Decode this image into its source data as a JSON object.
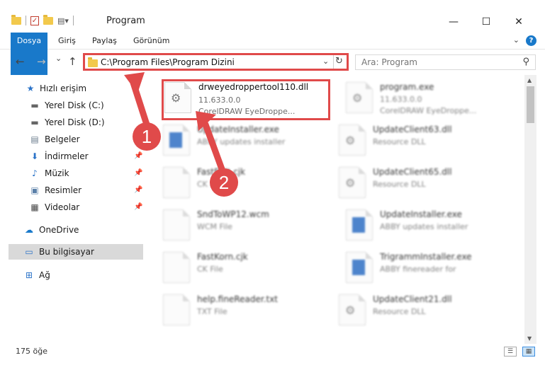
{
  "window": {
    "title": "Program",
    "minimize_glyph": "—",
    "maximize_glyph": "☐",
    "close_glyph": "✕"
  },
  "ribbon": {
    "tabs": [
      "Dosya",
      "Giriş",
      "Paylaş",
      "Görünüm"
    ],
    "help": "?"
  },
  "navbar": {
    "back": "←",
    "forward": "→",
    "recent": "⌄",
    "up": "↑",
    "address": "C:\\Program Files\\Program Dizini",
    "search_placeholder": "Ara: Program"
  },
  "sidebar": {
    "items": [
      {
        "label": "Hızlı erişim",
        "icon": "star-icon",
        "pinned": false
      },
      {
        "label": "Yerel Disk (C:)",
        "icon": "drive-icon",
        "pinned": false
      },
      {
        "label": "Yerel Disk (D:)",
        "icon": "drive-icon",
        "pinned": false
      },
      {
        "label": "Belgeler",
        "icon": "documents-icon",
        "pinned": false
      },
      {
        "label": "İndirmeler",
        "icon": "download-icon",
        "pinned": true
      },
      {
        "label": "Müzik",
        "icon": "music-icon",
        "pinned": true
      },
      {
        "label": "Resimler",
        "icon": "pictures-icon",
        "pinned": true
      },
      {
        "label": "Videolar",
        "icon": "video-icon",
        "pinned": true
      },
      {
        "label": "OneDrive",
        "icon": "cloud-icon",
        "pinned": false
      },
      {
        "label": "Bu bilgisayar",
        "icon": "computer-icon",
        "pinned": false,
        "selected": true
      },
      {
        "label": "Ağ",
        "icon": "network-icon",
        "pinned": false
      }
    ]
  },
  "files": {
    "left": [
      {
        "name": "drweyedroppertool110.dll",
        "line2": "11.633.0.0",
        "line3": "CorelDRAW EyeDroppe...",
        "icon": "dll-file-icon",
        "highlighted": true
      },
      {
        "name": "UpdateInstaller.exe",
        "line2": "ABBY updates installer",
        "line3": "",
        "icon": "exe-file-icon"
      },
      {
        "name": "FastEdit.cjk",
        "line2": "CK File",
        "line3": "",
        "icon": "generic-file-icon"
      },
      {
        "name": "SndToWP12.wcm",
        "line2": "WCM File",
        "line3": "",
        "icon": "generic-file-icon"
      },
      {
        "name": "FastKorn.cjk",
        "line2": "CK File",
        "line3": "",
        "icon": "generic-file-icon"
      },
      {
        "name": "help.fineReader.txt",
        "line2": "TXT File",
        "line3": "",
        "icon": "generic-file-icon"
      }
    ],
    "right": [
      {
        "name": "program.exe",
        "line2": "11.633.0.0",
        "line3": "CorelDRAW EyeDroppe...",
        "icon": "exe-file-icon"
      },
      {
        "name": "UpdateClient63.dll",
        "line2": "Resource DLL",
        "line3": "",
        "icon": "dll-file-icon"
      },
      {
        "name": "UpdateClient65.dll",
        "line2": "Resource DLL",
        "line3": "",
        "icon": "dll-file-icon"
      },
      {
        "name": "UpdateInstaller.exe",
        "line2": "ABBY updates installer",
        "line3": "",
        "icon": "exe-file-icon"
      },
      {
        "name": "TrigrammInstaller.exe",
        "line2": "ABBY finereader for",
        "line3": "",
        "icon": "exe-file-icon"
      },
      {
        "name": "UpdateClient21.dll",
        "line2": "Resource DLL",
        "line3": "",
        "icon": "dll-file-icon"
      }
    ]
  },
  "annotations": {
    "step1": "1",
    "step2": "2",
    "accent": "#e04a4a"
  },
  "status": {
    "count": "175 öğe"
  }
}
